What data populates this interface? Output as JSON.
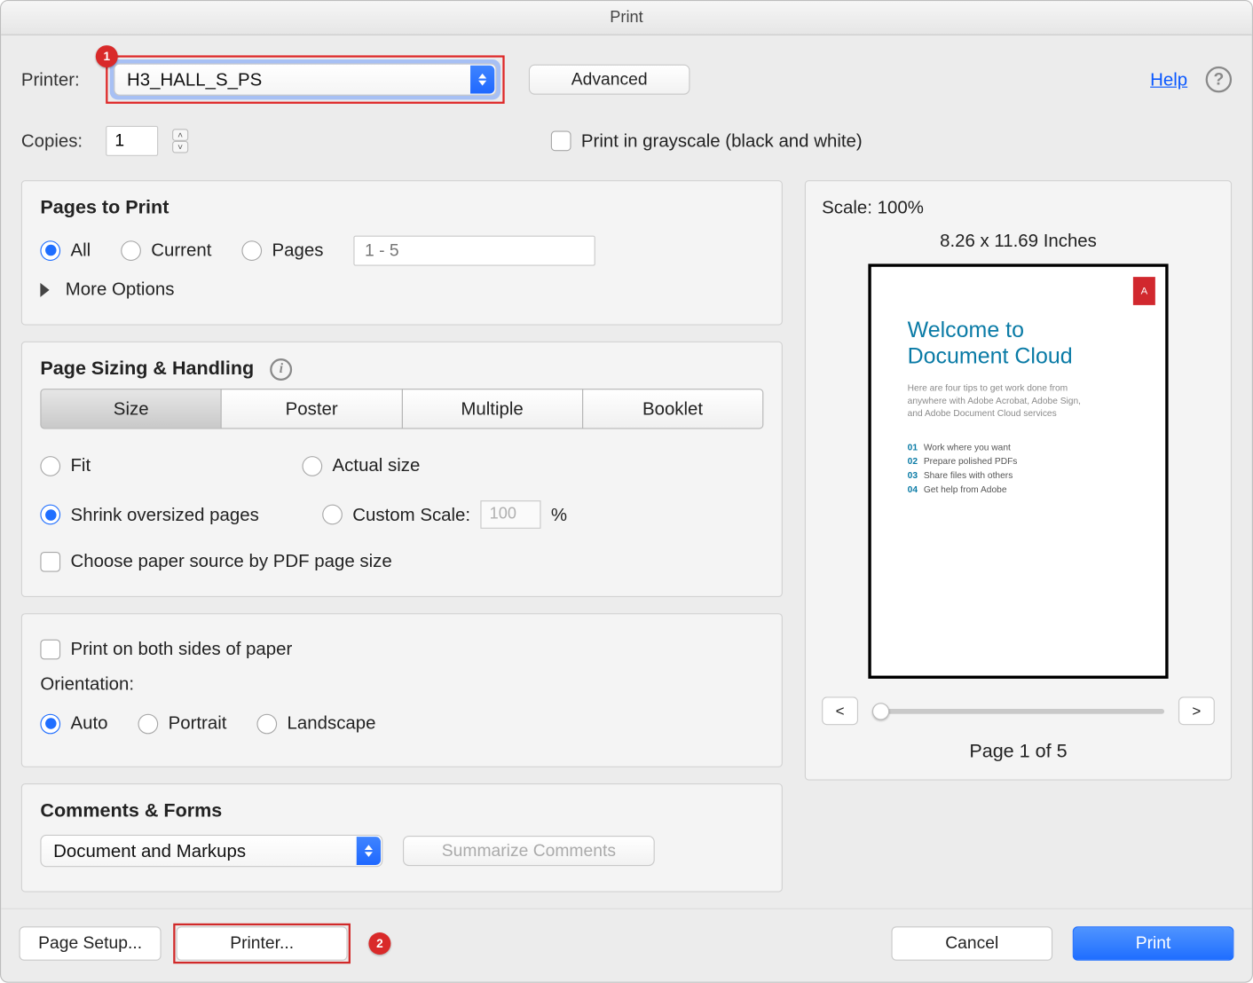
{
  "title": "Print",
  "help_link": "Help",
  "topbar": {
    "printer_label": "Printer:",
    "printer_value": "H3_HALL_S_PS",
    "advanced": "Advanced",
    "copies_label": "Copies:",
    "copies_value": "1",
    "grayscale": "Print in grayscale (black and white)"
  },
  "annotations": {
    "a1": "1",
    "a2": "2"
  },
  "pages": {
    "heading": "Pages to Print",
    "all": "All",
    "current": "Current",
    "pages": "Pages",
    "pages_placeholder": "1 - 5",
    "more": "More Options"
  },
  "sizing": {
    "heading": "Page Sizing & Handling",
    "seg": {
      "size": "Size",
      "poster": "Poster",
      "multiple": "Multiple",
      "booklet": "Booklet"
    },
    "fit": "Fit",
    "actual": "Actual size",
    "shrink": "Shrink oversized pages",
    "custom": "Custom Scale:",
    "custom_value": "100",
    "custom_pct": "%",
    "choose_paper": "Choose paper source by PDF page size"
  },
  "duplex": {
    "both_sides": "Print on both sides of paper",
    "orientation_label": "Orientation:",
    "auto": "Auto",
    "portrait": "Portrait",
    "landscape": "Landscape"
  },
  "comments": {
    "heading": "Comments & Forms",
    "value": "Document and Markups",
    "summarize": "Summarize Comments"
  },
  "preview": {
    "scale": "Scale: 100%",
    "dimensions": "8.26 x 11.69 Inches",
    "title_l1": "Welcome to",
    "title_l2": "Document Cloud",
    "sub": "Here are four tips to get work done from anywhere with Adobe Acrobat, Adobe Sign, and Adobe Document Cloud services",
    "items": [
      {
        "n": "01",
        "t": "Work where you want"
      },
      {
        "n": "02",
        "t": "Prepare polished PDFs"
      },
      {
        "n": "03",
        "t": "Share files with others"
      },
      {
        "n": "04",
        "t": "Get help from Adobe"
      }
    ],
    "prev": "<",
    "next": ">",
    "page_indicator": "Page 1 of 5"
  },
  "bottom": {
    "page_setup": "Page Setup...",
    "printer": "Printer...",
    "cancel": "Cancel",
    "print": "Print"
  }
}
